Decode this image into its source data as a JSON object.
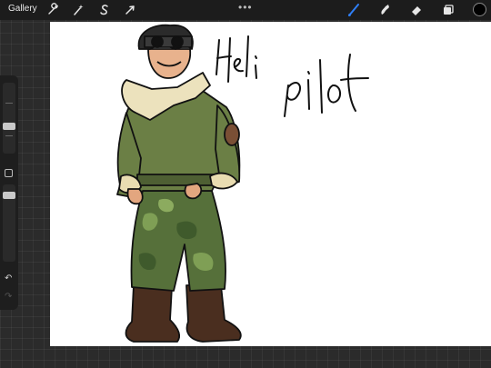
{
  "toolbar": {
    "gallery_label": "Gallery",
    "left_icons": [
      "wrench-icon",
      "magic-wand-icon",
      "selection-s-icon",
      "transform-arrow-icon"
    ],
    "more_label": "•••",
    "right_tools": [
      "brush-icon",
      "smudge-icon",
      "eraser-icon",
      "layers-icon"
    ],
    "active_tool": "brush-icon",
    "active_tool_color": "#2f7ff7",
    "current_color": "#000000"
  },
  "sidebar": {
    "undo_glyph": "↶",
    "redo_glyph": "↷"
  },
  "canvas": {
    "background": "#ffffff",
    "handwriting": [
      "Heli",
      "pilot"
    ]
  }
}
